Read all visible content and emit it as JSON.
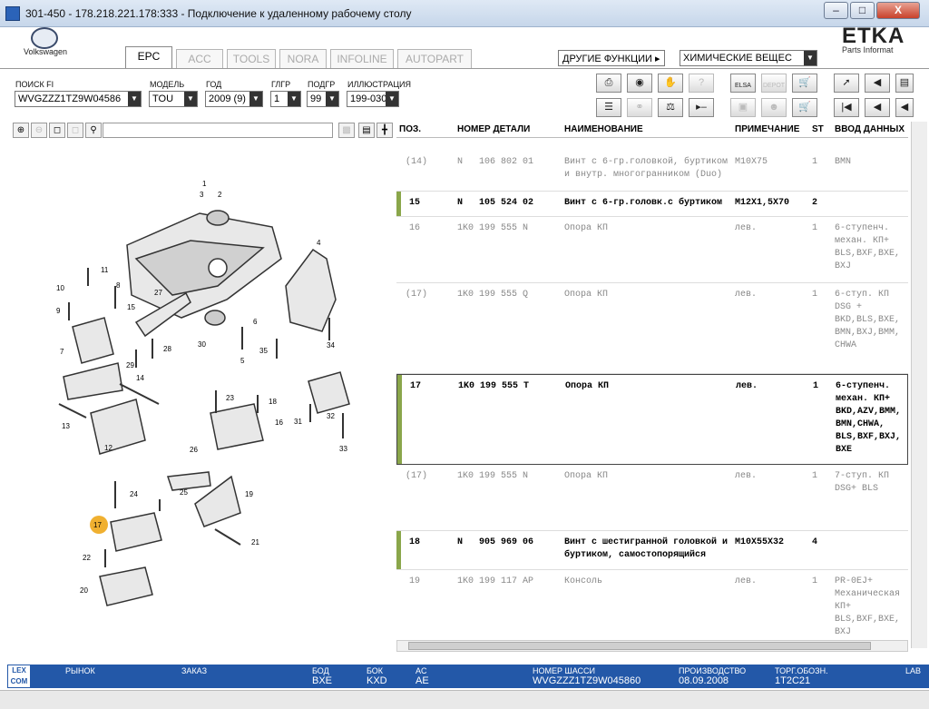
{
  "window": {
    "title": "301-450 - 178.218.221.178:333 - Подключение к удаленному рабочему столу",
    "buttons": {
      "minimize": "–",
      "maximize": "□",
      "close": "X"
    }
  },
  "header": {
    "brand": "Volkswagen",
    "etka": "ETKA",
    "etka_sub": "Parts Informat",
    "other_functions_label": "ДРУГИЕ ФУНКЦИИ",
    "other_functions_value": "ХИМИЧЕСКИЕ ВЕЩЕС"
  },
  "tabs": [
    "EPC",
    "ACC",
    "TOOLS",
    "NORA",
    "INFOLINE",
    "AUTOPART"
  ],
  "filters": {
    "fi": {
      "label": "ПОИСК FI",
      "value": "WVGZZZ1TZ9W04586"
    },
    "model": {
      "label": "МОДЕЛЬ",
      "value": "TOU"
    },
    "year": {
      "label": "ГОД",
      "value": "2009 (9)"
    },
    "glgr": {
      "label": "ГЛГР",
      "value": "1"
    },
    "podgr": {
      "label": "ПОДГР",
      "value": "99"
    },
    "illustration": {
      "label": "ИЛЛЮСТРАЦИЯ",
      "value": "199-030"
    }
  },
  "toolbar_icons": {
    "row1": [
      "printer-icon",
      "disc-icon",
      "handshake-icon",
      "question-chat-icon",
      "elsa-icon",
      "depot-icon",
      "cart-plus-icon",
      "pin-icon",
      "back-doc-icon",
      "doc-icon"
    ],
    "row2": [
      "list-icon",
      "key-icon",
      "scale-icon",
      "play-minus-icon",
      "window-arrows-icon",
      "person-cart-icon",
      "cart-icon",
      "first-icon",
      "prev-icon",
      "prev2-icon"
    ],
    "elsa_label": "ELSA",
    "depot_label": "DEPOT"
  },
  "table": {
    "headers": [
      "ПОЗ.",
      "НОМЕР ДЕТАЛИ",
      "НАИМЕНОВАНИЕ",
      "ПРИМЕЧАНИЕ",
      "ST",
      "ВВОД ДАННЫХ"
    ],
    "rows": [
      {
        "pos": "(14)",
        "part": "N   106 802 01",
        "name": "Винт с 6-гр.головкой, буртиком и внутр. многогранником (Duo)",
        "note": "M10X75",
        "st": "1",
        "data": "BMN",
        "style": "gray"
      },
      {
        "pos": "15",
        "part": "N   105 524 02",
        "name": "Винт с 6-гр.головк.с буртиком",
        "note": "M12X1,5X70",
        "st": "2",
        "data": "",
        "style": "bold"
      },
      {
        "pos": "16",
        "part": "1K0 199 555 N",
        "name": "Опора КП",
        "note": "лев.",
        "st": "1",
        "data": "6-ступенч. механ. КП+ BLS,BXF,BXE, BXJ",
        "style": "gray"
      },
      {
        "pos": "(17)",
        "part": "1K0 199 555 Q",
        "name": "Опора КП",
        "note": "лев.",
        "st": "1",
        "data": "6-ступ. КП DSG + BKD,BLS,BXE, BMN,BXJ,BMM, CHWA",
        "style": "gray"
      },
      {
        "pos": "17",
        "part": "1K0 199 555 T",
        "name": "Опора КП",
        "note": "лев.",
        "st": "1",
        "data": "6-ступенч. механ. КП+ BKD,AZV,BMM, BMN,CHWA, BLS,BXF,BXJ, BXE",
        "style": "bold"
      },
      {
        "pos": "(17)",
        "part": "1K0 199 555 N",
        "name": "Опора КП",
        "note": "лев.",
        "st": "1",
        "data": "7-ступ. КП DSG+ BLS",
        "style": "gray"
      },
      {
        "pos": "18",
        "part": "N   905 969 06",
        "name": "Винт с шестигранной головкой и буртиком, самостопорящийся",
        "note": "M10X55X32",
        "st": "4",
        "data": "",
        "style": "bold"
      },
      {
        "pos": "19",
        "part": "1K0 199 117 AP",
        "name": "Консоль",
        "note": "лев.",
        "st": "1",
        "data": "PR-0EJ+ Механическая КП+ BLS,BXF,BXE, BXJ",
        "style": "gray"
      }
    ]
  },
  "diagram_labels": [
    "1",
    "2",
    "3",
    "4",
    "5",
    "6",
    "7",
    "8",
    "9",
    "10",
    "11",
    "12",
    "13",
    "14",
    "15",
    "16",
    "17",
    "18",
    "19",
    "20",
    "21",
    "22",
    "23",
    "24",
    "25",
    "26",
    "27",
    "28",
    "29",
    "30",
    "31",
    "32",
    "33",
    "34",
    "35"
  ],
  "status": {
    "market_label": "РЫНОК",
    "order_label": "ЗАКАЗ",
    "bod_label": "БОД",
    "bod_value": "BXE",
    "bok_label": "БОК",
    "bok_value": "KXD",
    "ac_label": "AC",
    "ac_value": "AE",
    "chassis_label": "НОМЕР ШАССИ",
    "chassis_value": "WVGZZZ1TZ9W045860",
    "prod_label": "ПРОИЗВОДСТВО",
    "prod_value": "08.09.2008",
    "trade_label": "ТОРГ.ОБОЗН.",
    "trade_value": "1T2C21",
    "lab_label": "LAB",
    "lexcom": "LEX COM"
  }
}
